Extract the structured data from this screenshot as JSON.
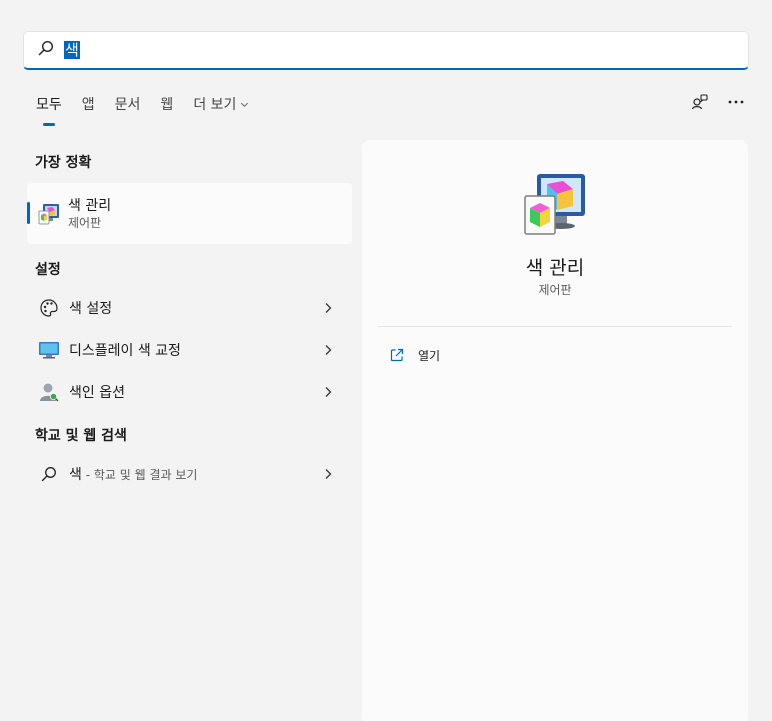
{
  "search": {
    "query": "색"
  },
  "tabs": [
    {
      "label": "모두"
    },
    {
      "label": "앱"
    },
    {
      "label": "문서"
    },
    {
      "label": "웹"
    },
    {
      "label": "더 보기"
    }
  ],
  "left": {
    "best_match_title": "가장 정확",
    "best_match": {
      "title": "색 관리",
      "subtitle": "제어판"
    },
    "settings_title": "설정",
    "settings": [
      {
        "label": "색 설정",
        "icon": "palette-icon"
      },
      {
        "label": "디스플레이 색 교정",
        "icon": "monitor-icon"
      },
      {
        "label": "색인 옵션",
        "icon": "user-search-icon"
      }
    ],
    "web_title": "학교 및 웹 검색",
    "web_item": {
      "label": "색",
      "suffix": " - 학교 및 웹 결과 보기"
    }
  },
  "right": {
    "title": "색 관리",
    "subtitle": "제어판",
    "actions": [
      {
        "label": "열기"
      }
    ]
  },
  "colors": {
    "accent": "#0067c0",
    "background": "#f3f3f3",
    "pane": "#fbfbfb"
  }
}
